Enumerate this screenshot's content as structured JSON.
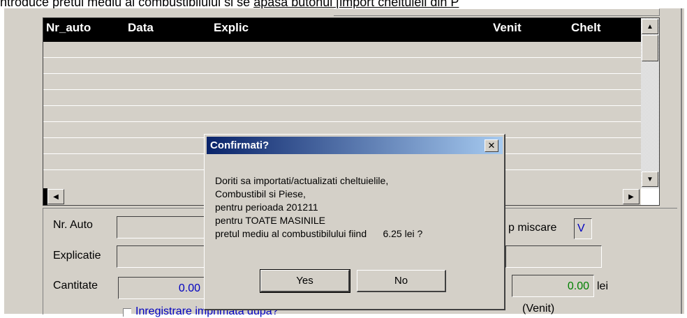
{
  "top_text": {
    "before": "ntroduce pretul mediu al combustibilului si se ",
    "underlined": "apasa butonul [import cheltuieli din P"
  },
  "grid": {
    "columns": [
      "Nr_auto",
      "Data",
      "Explic",
      "Venit",
      "Chelt"
    ]
  },
  "form": {
    "nr_auto_label": "Nr. Auto",
    "explicatie_label": "Explicatie",
    "cantitate_label": "Cantitate",
    "cantitate_value": "0.00",
    "tip_miscare_label": "p miscare",
    "tip_miscare_value": "V",
    "suma_value": "0.00",
    "suma_unit": "lei",
    "venit_label": "(Venit)",
    "checkbox_label": "Inregistrare imprimata dupa?"
  },
  "dialog": {
    "title": "Confirmati?",
    "lines": [
      "Doriti sa importati/actualizati cheltuielile,",
      "Combustibil si Piese,",
      "pentru perioada 201211",
      "pentru  TOATE MASINILE",
      "pretul mediu al combustibilului fiind      6.25 lei ?"
    ],
    "yes_label": "Yes",
    "no_label": "No"
  },
  "colors": {
    "titlebar_start": "#0a246a",
    "titlebar_end": "#a6caf0",
    "face": "#d4d0c8",
    "value_blue": "#0000c0",
    "value_green": "#008000"
  }
}
